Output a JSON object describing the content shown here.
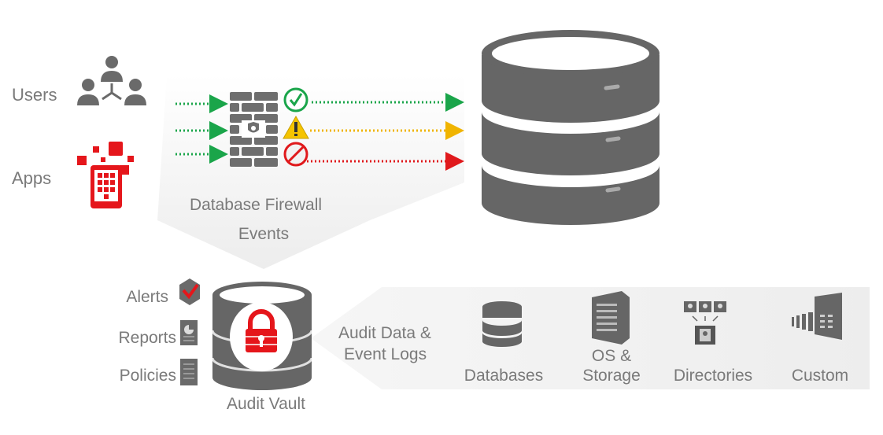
{
  "sources": {
    "users": "Users",
    "apps": "Apps"
  },
  "firewall": {
    "label_line1": "Database Firewall",
    "label_line2": "Events"
  },
  "outputs": {
    "alerts": "Alerts",
    "reports": "Reports",
    "policies": "Policies"
  },
  "vault": {
    "label": "Audit Vault"
  },
  "feed": {
    "label_line1": "Audit Data &",
    "label_line2": "Event Logs"
  },
  "targets": [
    {
      "label": "Databases"
    },
    {
      "label_line1": "OS &",
      "label_line2": "Storage"
    },
    {
      "label": "Directories"
    },
    {
      "label": "Custom"
    }
  ],
  "colors": {
    "allow": "#1aa54a",
    "warn": "#f0b400",
    "block": "#e0191c",
    "brand_red": "#e5161b",
    "gray": "#6a6a6a",
    "text": "#7a7a7a"
  },
  "flows": [
    "allow",
    "warn",
    "block"
  ]
}
